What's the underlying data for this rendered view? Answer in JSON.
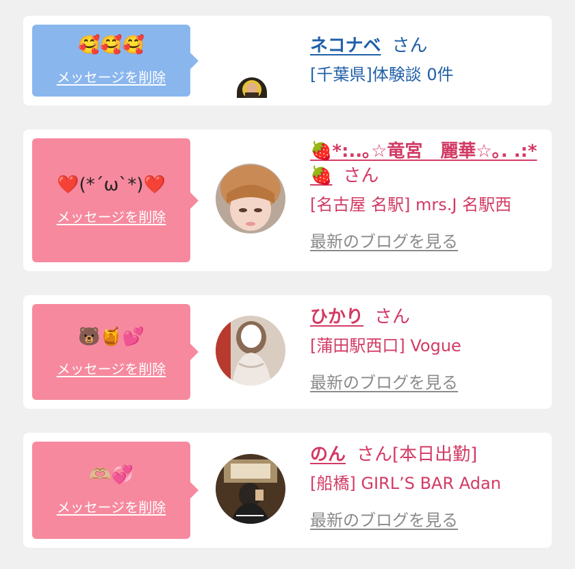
{
  "messages": [
    {
      "emoji": "🥰🥰🥰",
      "delete_label": "メッセージを削除",
      "name": "ネコナベ",
      "suffix": "さん",
      "shop": "[千葉県]体験談 0件",
      "blog_label": ""
    },
    {
      "emoji": "❤️(*´ω`*)❤️",
      "delete_label": "メッセージを削除",
      "name": "🍓*:..｡☆竜宮　麗華☆｡. .:*🍓",
      "suffix": "さん",
      "shop": "[名古屋 名駅] mrs.J 名駅西",
      "blog_label": "最新のブログを見る"
    },
    {
      "emoji": "🐻🍯💕",
      "delete_label": "メッセージを削除",
      "name": "ひかり",
      "suffix": "さん",
      "shop": "[蒲田駅西口] Vogue",
      "blog_label": "最新のブログを見る"
    },
    {
      "emoji": "🫶🏼💞",
      "delete_label": "メッセージを削除",
      "name": "のん",
      "suffix": "さん[本日出勤]",
      "shop": "[船橋] GIRL’S BAR Adan",
      "blog_label": "最新のブログを見る"
    }
  ],
  "colors": {
    "blue_bubble": "#8ab6ee",
    "pink_bubble": "#f6899e",
    "blue_text": "#1f5fa8",
    "pink_text": "#d23a64",
    "link_gray": "#8a8a8a"
  }
}
